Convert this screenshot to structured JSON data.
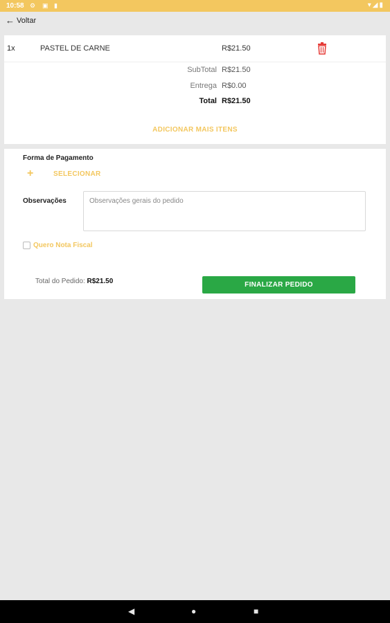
{
  "status": {
    "time": "10:58",
    "icons": [
      "gear-icon",
      "sim-icon",
      "clipboard-icon"
    ],
    "right_icons": [
      "wifi-icon",
      "signal-icon",
      "battery-icon"
    ]
  },
  "nav": {
    "back_label": "Voltar"
  },
  "cart": {
    "items": [
      {
        "qty": "1x",
        "name": "PASTEL DE CARNE",
        "price": "R$21.50"
      }
    ],
    "subtotal_label": "SubTotal",
    "subtotal_value": "R$21.50",
    "delivery_label": "Entrega",
    "delivery_value": "R$0.00",
    "total_label": "Total",
    "total_value": "R$21.50",
    "add_more_label": "ADICIONAR MAIS ITENS"
  },
  "payment": {
    "title": "Forma de Pagamento",
    "select_label": "SELECIONAR"
  },
  "notes": {
    "label": "Observações",
    "placeholder": "Observações gerais do pedido",
    "value": ""
  },
  "invoice": {
    "label": "Quero Nota Fiscal",
    "checked": false
  },
  "footer": {
    "order_total_label": "Total do Pedido:",
    "order_total_value": "R$21.50",
    "finalize_label": "FINALIZAR PEDIDO"
  },
  "colors": {
    "accent": "#f3c75f",
    "confirm": "#2aa845",
    "delete": "#e53935",
    "background": "#e8e8e8"
  }
}
